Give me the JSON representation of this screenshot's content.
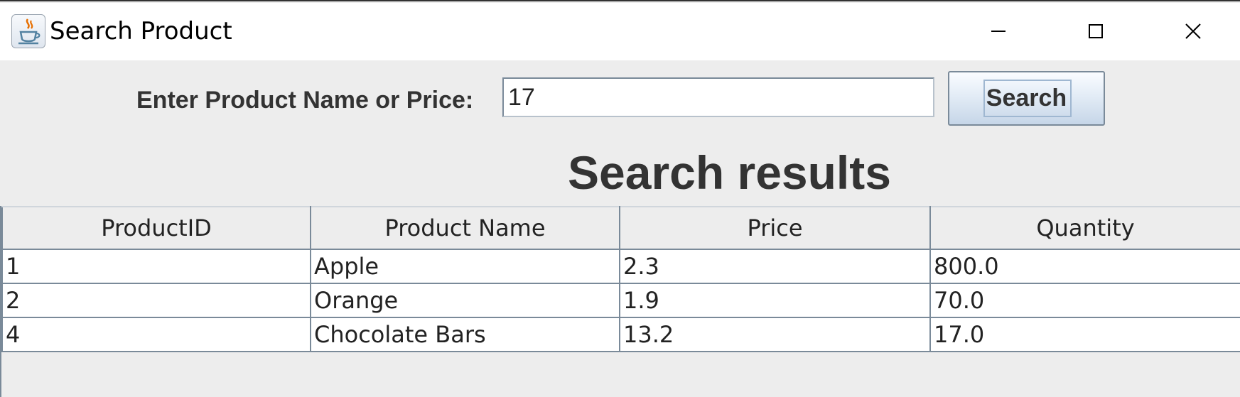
{
  "window": {
    "title": "Search Product",
    "icon": "java-cup-icon",
    "controls": [
      "minimize-icon",
      "maximize-icon",
      "close-icon"
    ]
  },
  "search": {
    "label": "Enter Product Name or Price:",
    "value": "17",
    "button_label": "Search"
  },
  "results": {
    "heading": "Search results",
    "columns": [
      "ProductID",
      "Product Name",
      "Price",
      "Quantity"
    ],
    "rows": [
      [
        "1",
        "Apple",
        "2.3",
        "800.0"
      ],
      [
        "2",
        "Orange",
        "1.9",
        "70.0"
      ],
      [
        "4",
        "Chocolate Bars",
        "13.2",
        "17.0"
      ]
    ]
  },
  "colors": {
    "background": "#ededed",
    "border": "#7a8a99",
    "text": "#333333"
  }
}
